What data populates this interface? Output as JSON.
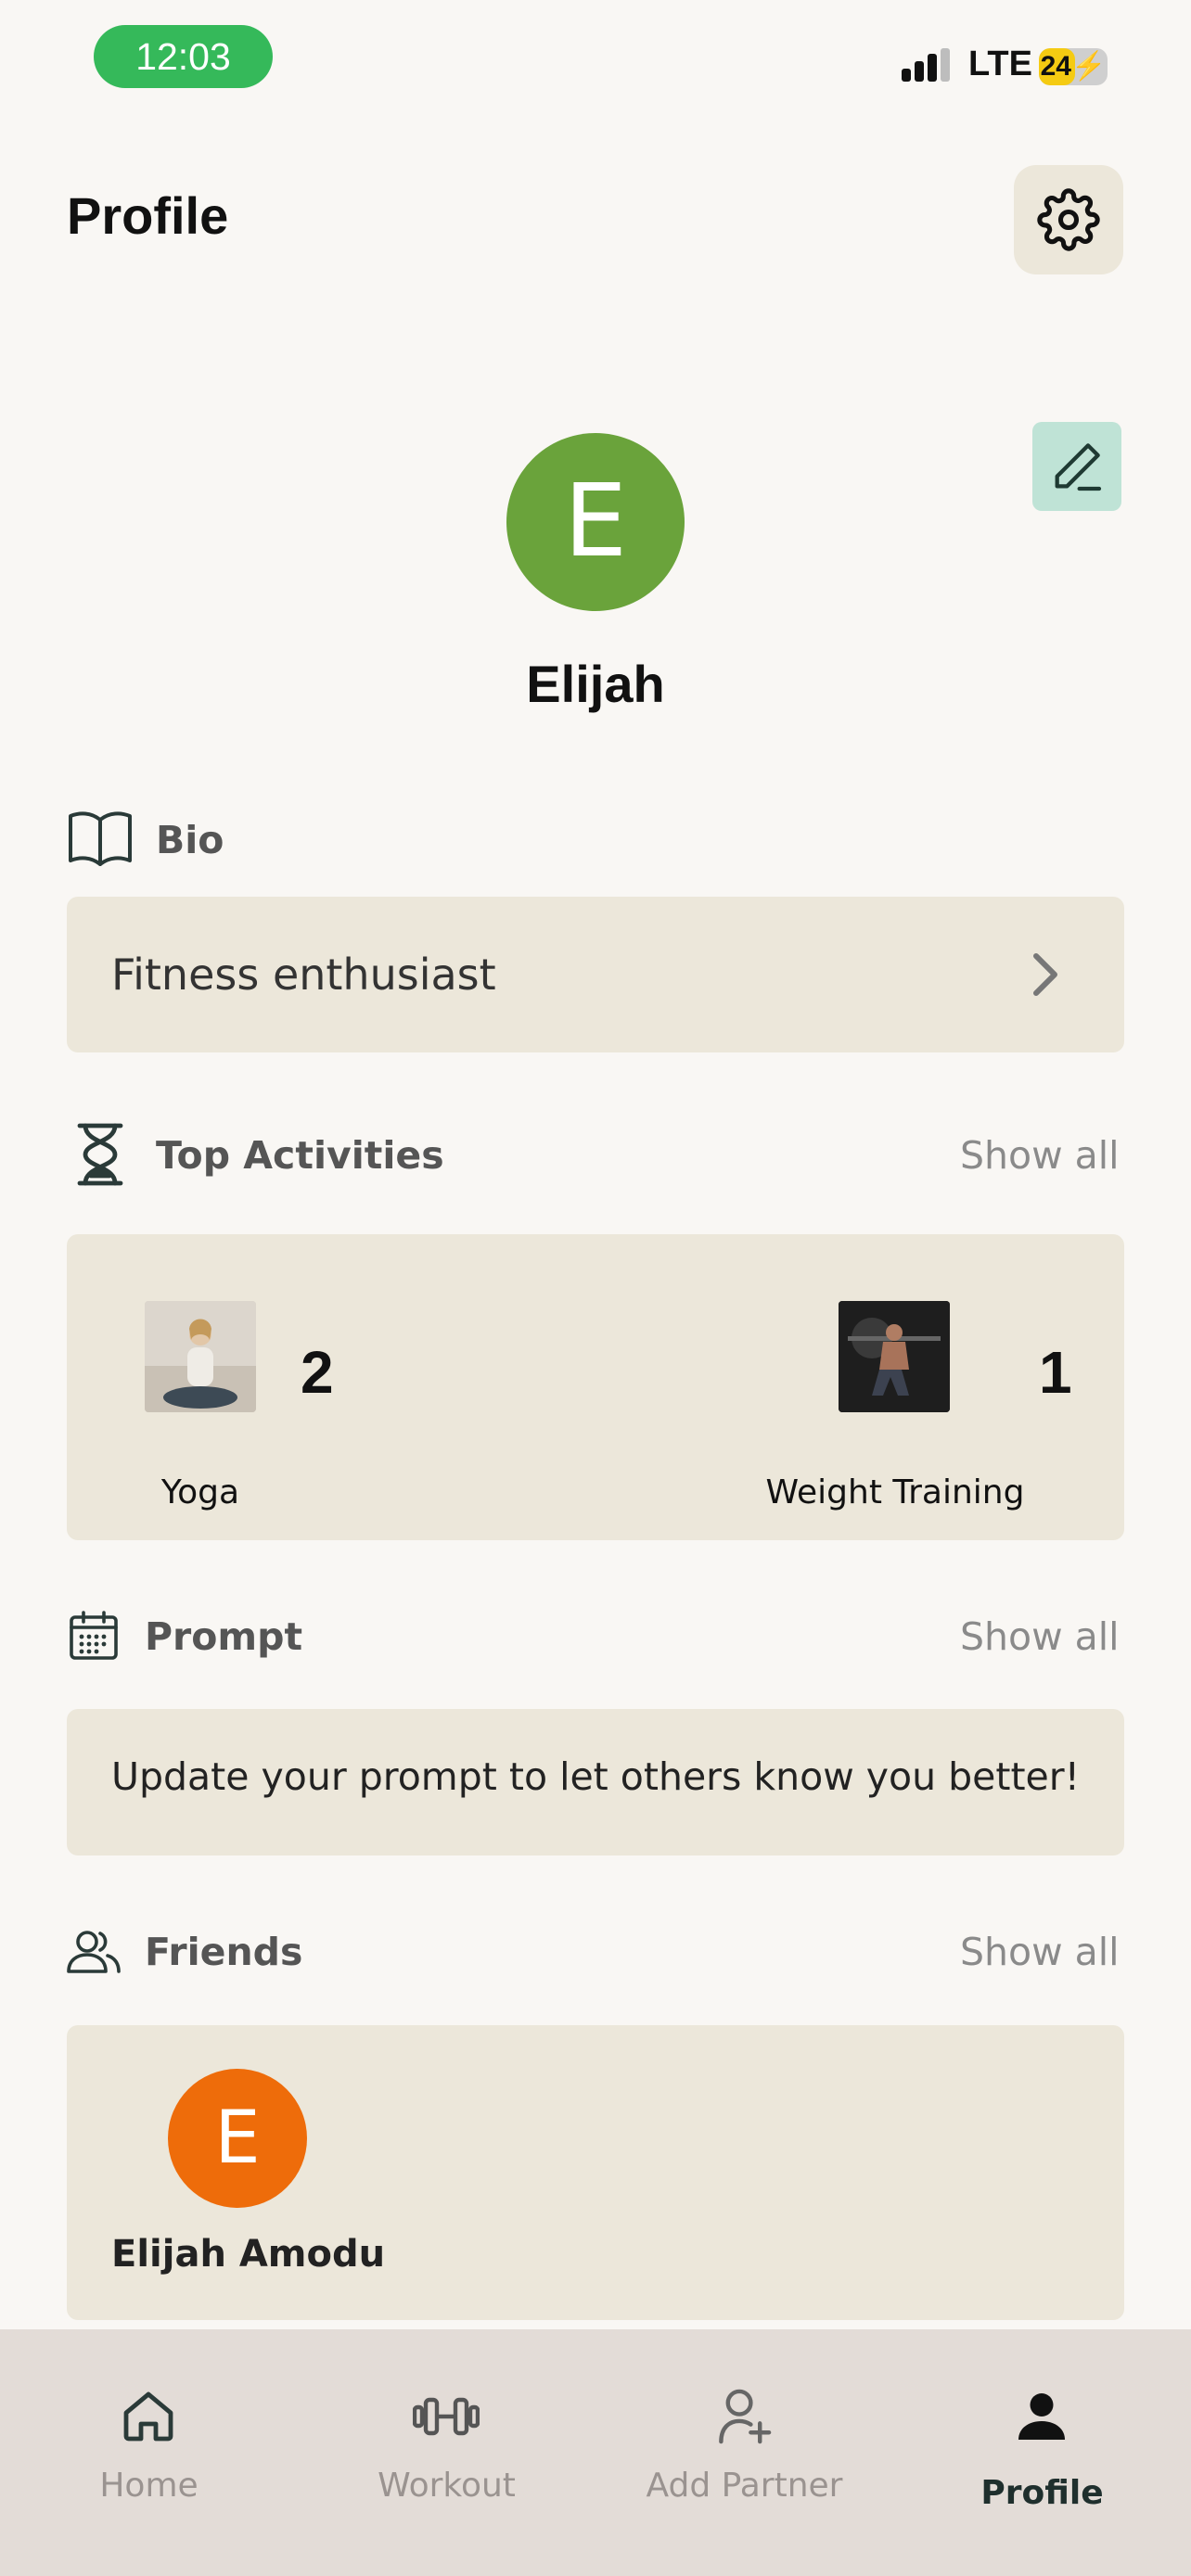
{
  "status_bar": {
    "time": "12:03",
    "network": "LTE",
    "battery": "24",
    "battery_level": 0.24
  },
  "header": {
    "title": "Profile",
    "settings_icon": "gear-icon"
  },
  "profile": {
    "edit_icon": "pencil-icon",
    "avatar_initial": "E",
    "avatar_color": "#6aa33b",
    "name": "Elijah"
  },
  "bio": {
    "label": "Bio",
    "icon": "book-icon",
    "text": "Fitness enthusiast"
  },
  "top_activities": {
    "label": "Top Activities",
    "icon": "hourglass-icon",
    "show_all": "Show all",
    "items": [
      {
        "name": "Yoga",
        "count": "2"
      },
      {
        "name": "Weight Training",
        "count": "1"
      }
    ]
  },
  "prompt": {
    "label": "Prompt",
    "icon": "calendar-icon",
    "show_all": "Show all",
    "text": "Update your prompt to let others know you better!"
  },
  "friends": {
    "label": "Friends",
    "icon": "users-icon",
    "show_all": "Show all",
    "items": [
      {
        "initial": "E",
        "name": "Elijah Amodu",
        "color": "#ee6c0a"
      }
    ]
  },
  "bottom_nav": {
    "items": [
      {
        "label": "Home",
        "icon": "home-icon"
      },
      {
        "label": "Workout",
        "icon": "dumbbell-icon"
      },
      {
        "label": "Add Partner",
        "icon": "add-user-icon"
      },
      {
        "label": "Profile",
        "icon": "person-icon",
        "active": true
      }
    ]
  }
}
